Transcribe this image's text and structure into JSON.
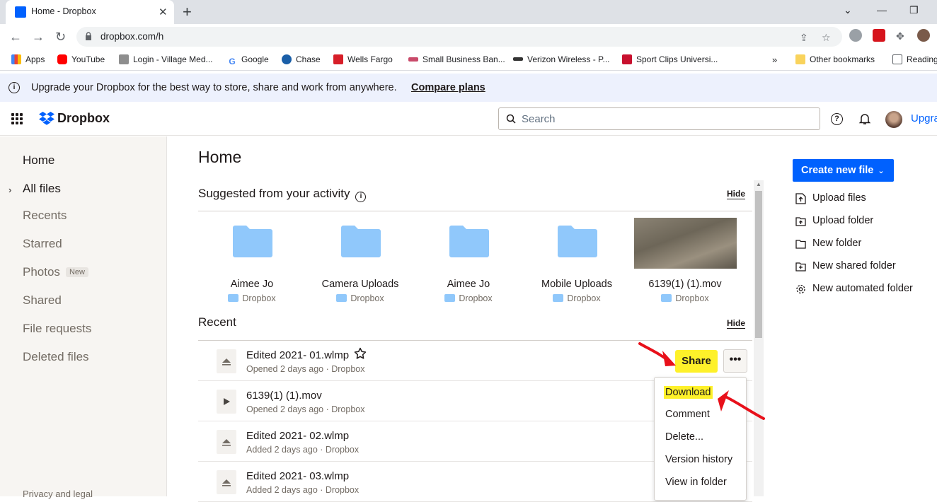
{
  "browser": {
    "tab_title": "Home - Dropbox",
    "url": "dropbox.com/h",
    "bookmarks": [
      "Apps",
      "YouTube",
      "Login - Village Med...",
      "Google",
      "Chase",
      "Wells Fargo",
      "Small Business Ban...",
      "Verizon Wireless - P...",
      "Sport Clips Universi...",
      "Other bookmarks",
      "Reading"
    ]
  },
  "banner": {
    "text": "Upgrade your Dropbox for the best way to store, share and work from anywhere.",
    "cta": "Compare plans"
  },
  "header": {
    "logo_text": "Dropbox",
    "search_placeholder": "Search",
    "upgrade_label": "Upgra"
  },
  "sidebar": {
    "items": [
      {
        "label": "Home"
      },
      {
        "label": "All files"
      },
      {
        "label": "Recents"
      },
      {
        "label": "Starred"
      },
      {
        "label": "Photos",
        "badge": "New"
      },
      {
        "label": "Shared"
      },
      {
        "label": "File requests"
      },
      {
        "label": "Deleted files"
      }
    ],
    "footer": "Privacy and legal"
  },
  "main": {
    "title": "Home",
    "suggested": {
      "heading": "Suggested from your activity",
      "hide": "Hide",
      "cards": [
        {
          "name": "Aimee Jo",
          "location": "Dropbox"
        },
        {
          "name": "Camera Uploads",
          "location": "Dropbox"
        },
        {
          "name": "Aimee Jo",
          "location": "Dropbox"
        },
        {
          "name": "Mobile Uploads",
          "location": "Dropbox"
        },
        {
          "name": "6139(1) (1).mov",
          "location": "Dropbox"
        }
      ]
    },
    "recent": {
      "heading": "Recent",
      "hide": "Hide",
      "rows": [
        {
          "name": "Edited 2021- 01.wlmp",
          "meta": "Opened 2 days ago · Dropbox"
        },
        {
          "name": "6139(1) (1).mov",
          "meta": "Opened 2 days ago · Dropbox"
        },
        {
          "name": "Edited 2021- 02.wlmp",
          "meta": "Added 2 days ago · Dropbox"
        },
        {
          "name": "Edited 2021- 03.wlmp",
          "meta": "Added 2 days ago · Dropbox"
        }
      ],
      "share_label": "Share",
      "more_label": "•••"
    },
    "context_menu": [
      "Download",
      "Comment",
      "Delete...",
      "Version history",
      "View in folder"
    ]
  },
  "actions": {
    "create_label": "Create new file",
    "items": [
      "Upload files",
      "Upload folder",
      "New folder",
      "New shared folder",
      "New automated folder"
    ]
  },
  "colors": {
    "accent": "#0061fe",
    "highlight": "#fef12a",
    "annotation": "#e8101a",
    "folder": "#90c8fb"
  }
}
